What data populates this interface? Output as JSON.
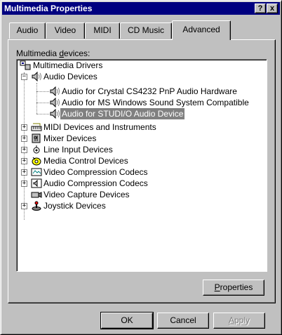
{
  "window": {
    "title": "Multimedia Properties",
    "help_glyph": "?",
    "close_glyph": "x"
  },
  "tabs": [
    {
      "label": "Audio"
    },
    {
      "label": "Video"
    },
    {
      "label": "MIDI"
    },
    {
      "label": "CD Music"
    },
    {
      "label": "Advanced",
      "active": true
    }
  ],
  "devices_label": {
    "access_key": "M",
    "pre": "Multimedia ",
    "key": "d",
    "post": "evices:"
  },
  "tree": {
    "root": "Multimedia Drivers",
    "audio_devices": "Audio Devices",
    "audio_children": [
      "Audio for Crystal CS4232 PnP Audio Hardware",
      "Audio for MS Windows Sound System Compatible",
      "Audio for STUDI/O Audio Device"
    ],
    "selected": "Audio for STUDI/O Audio Device",
    "categories": [
      {
        "label": "MIDI Devices and Instruments",
        "icon": "midi-icon"
      },
      {
        "label": "Mixer Devices",
        "icon": "mixer-icon"
      },
      {
        "label": "Line Input Devices",
        "icon": "line-input-icon"
      },
      {
        "label": "Media Control Devices",
        "icon": "media-control-icon"
      },
      {
        "label": "Video Compression Codecs",
        "icon": "video-codec-icon"
      },
      {
        "label": "Audio Compression Codecs",
        "icon": "audio-codec-icon"
      },
      {
        "label": "Video Capture Devices",
        "icon": "video-capture-icon"
      },
      {
        "label": "Joystick Devices",
        "icon": "joystick-icon"
      }
    ]
  },
  "buttons": {
    "properties_key": "P",
    "properties_rest": "roperties",
    "ok": "OK",
    "cancel": "Cancel",
    "apply_key": "A",
    "apply_rest": "pply"
  },
  "colors": {
    "title_bar": "#000080",
    "face": "#c0c0c0",
    "selection": "#808080"
  }
}
